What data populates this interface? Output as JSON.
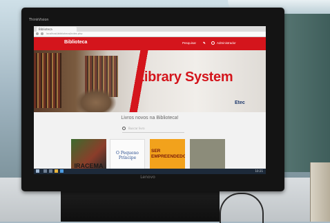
{
  "monitor": {
    "corner_mark": "ThinkVision",
    "brand": "Lenovo"
  },
  "browser": {
    "tab_title": "Biblioteca",
    "address": "localhost/biblioteca/index.php"
  },
  "site": {
    "brand": "Biblioteca",
    "nav": {
      "search": "Pesquisar",
      "admin": "Administrador"
    },
    "hero_title": "Library System",
    "hero_logo": "Etec",
    "section_title": "Livros novos na Biblioteca!",
    "search_placeholder": "Buscar livro",
    "books": [
      {
        "title": "IRACEMA"
      },
      {
        "title": "O Pequeno Príncipe"
      },
      {
        "title": "SER EMPREENDEDOR"
      },
      {
        "title": ""
      }
    ]
  },
  "taskbar": {
    "time": "10:21"
  },
  "colors": {
    "brand_red": "#d4151c",
    "taskbar": "#1d2a3a"
  }
}
